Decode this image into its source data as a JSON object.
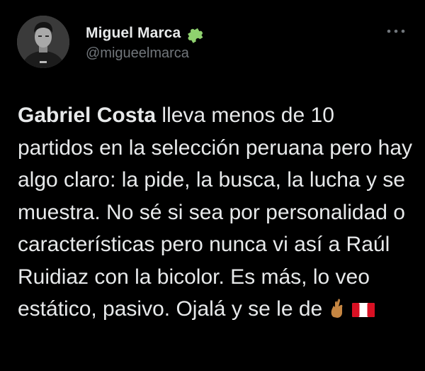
{
  "author": {
    "display_name": "Miguel Marca",
    "handle": "@migueelmarca",
    "badge_icon": "puzzle-piece-icon",
    "badge_color": "#8fd16f"
  },
  "menu": {
    "icon": "more-horizontal-icon"
  },
  "tweet": {
    "bold_name": "Gabriel Costa",
    "body": " lleva menos de 10 partidos en la selección peruana pero hay algo claro: la pide, la busca, la lucha y se muestra. No sé si sea por personalidad o características pero nunca vi así a Raúl Ruidiaz con la bicolor. Es más, lo veo estático, pasivo. Ojalá y se le de",
    "emojis": [
      "crossed-fingers-icon",
      "peru-flag-icon"
    ]
  },
  "colors": {
    "background": "#000000",
    "text": "#e7e9ea",
    "secondary_text": "#71767b"
  }
}
